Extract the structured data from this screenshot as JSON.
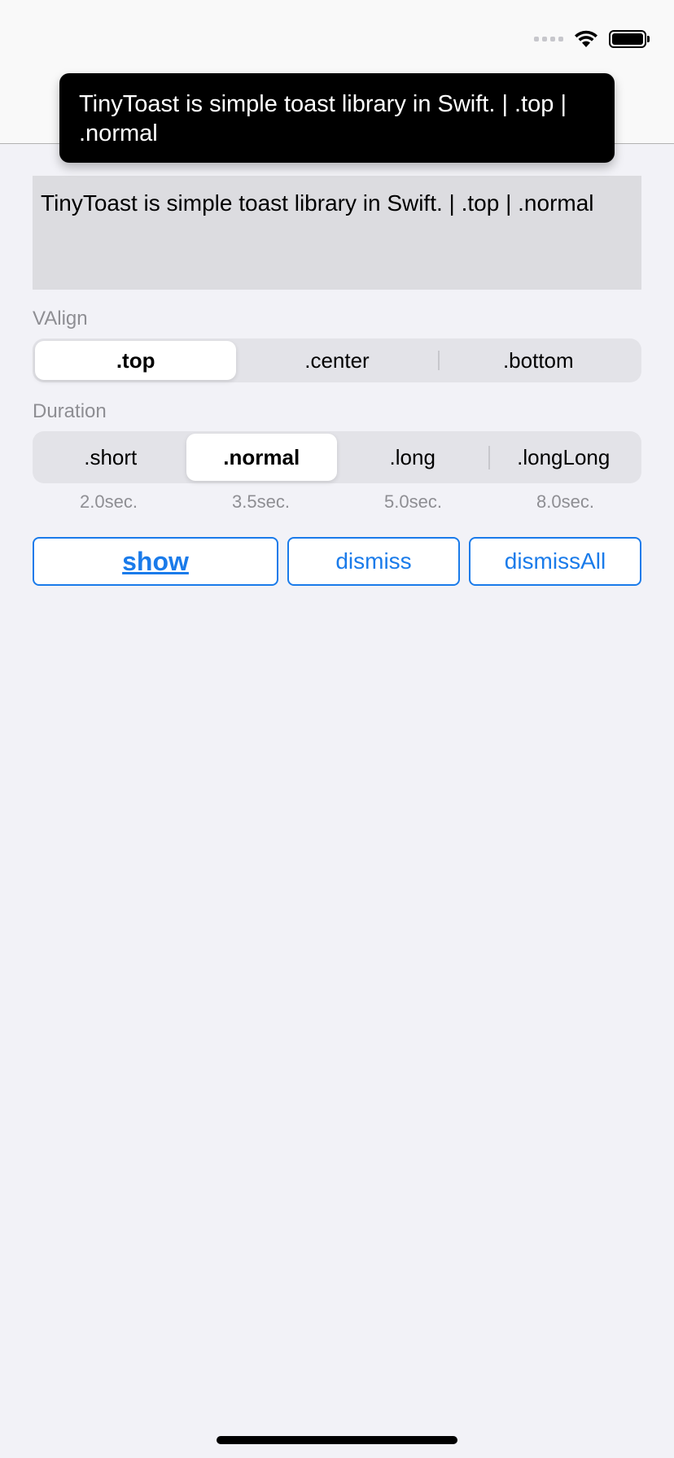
{
  "toast": {
    "message": "TinyToast is simple toast library in Swift. | .top | .normal"
  },
  "textview": {
    "value": "TinyToast is simple toast library in Swift. | .top | .normal"
  },
  "valign": {
    "label": "VAlign",
    "options": [
      ".top",
      ".center",
      ".bottom"
    ],
    "selected": ".top"
  },
  "duration": {
    "label": "Duration",
    "options": [
      ".short",
      ".normal",
      ".long",
      ".longLong"
    ],
    "selected": ".normal",
    "seconds": [
      "2.0sec.",
      "3.5sec.",
      "5.0sec.",
      "8.0sec."
    ]
  },
  "buttons": {
    "show": "show",
    "dismiss": "dismiss",
    "dismiss_all": "dismissAll"
  },
  "colors": {
    "accent": "#1a7bea",
    "background": "#f2f2f7",
    "toast_background": "#000000"
  },
  "icons": {
    "signal": "cellular-signal-icon",
    "wifi": "wifi-icon",
    "battery": "battery-icon"
  }
}
